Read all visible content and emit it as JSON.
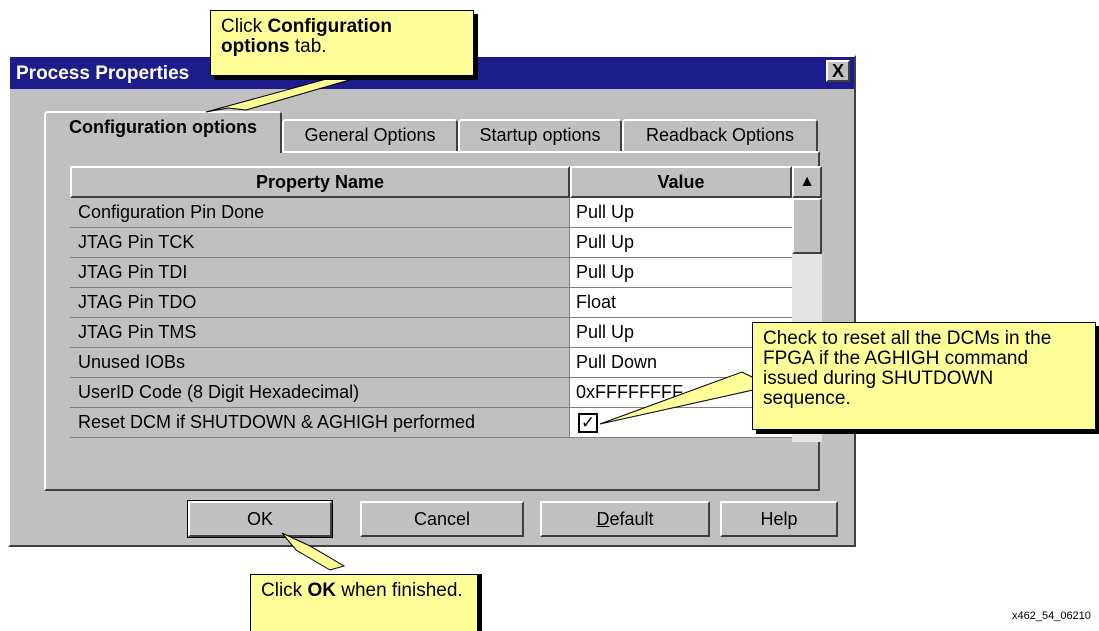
{
  "window": {
    "title": "Process Properties",
    "close_label": "X"
  },
  "tabs": [
    {
      "label": "Configuration options",
      "active": true
    },
    {
      "label": "General Options",
      "active": false
    },
    {
      "label": "Startup options",
      "active": false
    },
    {
      "label": "Readback Options",
      "active": false
    }
  ],
  "table": {
    "headers": [
      "Property Name",
      "Value"
    ],
    "rows": [
      {
        "name": "Configuration Pin Done",
        "value": "Pull Up"
      },
      {
        "name": "JTAG Pin TCK",
        "value": "Pull Up"
      },
      {
        "name": "JTAG Pin TDI",
        "value": "Pull Up"
      },
      {
        "name": "JTAG Pin TDO",
        "value": "Float"
      },
      {
        "name": "JTAG Pin TMS",
        "value": "Pull Up"
      },
      {
        "name": "Unused IOBs",
        "value": "Pull Down"
      },
      {
        "name": "UserID Code (8 Digit Hexadecimal)",
        "value": "0xFFFFFFFF"
      },
      {
        "name": "Reset DCM if SHUTDOWN & AGHIGH performed",
        "value": "✓",
        "checked": true
      }
    ],
    "scroll_up_glyph": "▲"
  },
  "buttons": {
    "ok": "OK",
    "cancel": "Cancel",
    "default": {
      "mnemonic": "D",
      "rest": "efault"
    },
    "help": "Help"
  },
  "callouts": {
    "tab": {
      "pre": "Click ",
      "bold": "Configuration options",
      "post": " tab."
    },
    "ok": {
      "pre": "Click ",
      "bold": "OK",
      "post": " when finished."
    },
    "checkbox": {
      "text": "Check to reset all the DCMs in the FPGA if the AGHIGH command issued during SHUTDOWN sequence."
    }
  },
  "figure_id": "x462_54_06210",
  "colors": {
    "titlebar": "#1c1c8c",
    "callout": "#ffff99",
    "dialog": "#c0c0c0"
  }
}
